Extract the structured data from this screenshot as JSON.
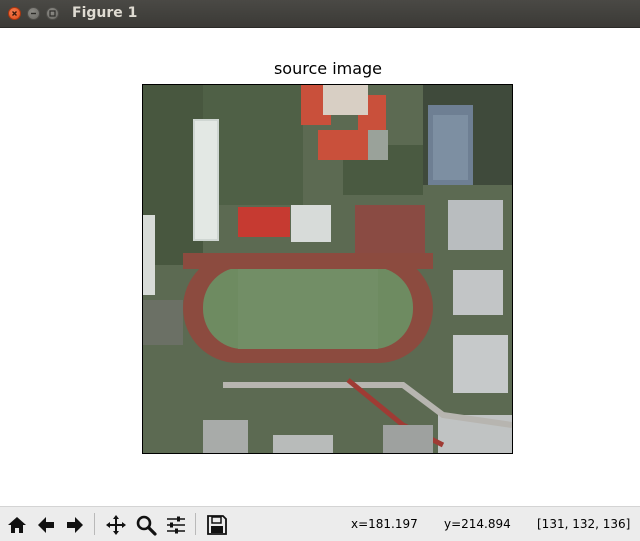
{
  "window": {
    "title": "Figure 1"
  },
  "figure": {
    "title": "source image"
  },
  "toolbar": {
    "buttons": [
      "home-icon",
      "back-arrow-icon",
      "forward-arrow-icon",
      "pan-icon",
      "zoom-icon",
      "configure-subplots-icon",
      "save-icon"
    ]
  },
  "status": {
    "x": "x=181.197",
    "y": "y=214.894",
    "pixel": "[131, 132, 136]"
  },
  "colors": {
    "titlebar": "#3c3b37",
    "close_button": "#e5531a",
    "toolbar_bg": "#ececec",
    "track": "#8e4a3e",
    "field": "#6f8a5e",
    "red_roof": "#c8432f"
  }
}
